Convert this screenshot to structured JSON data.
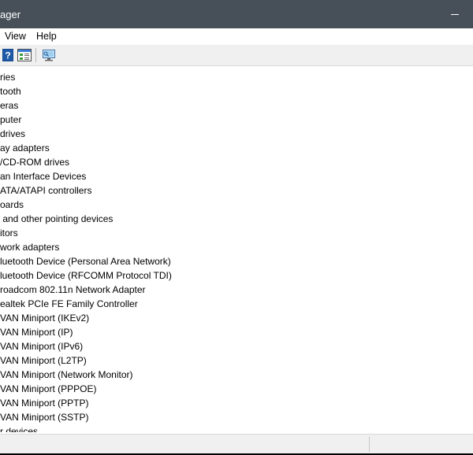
{
  "window": {
    "title": "ager"
  },
  "menu": {
    "items": [
      "View",
      "Help"
    ]
  },
  "toolbar": {
    "buttons": [
      "help-icon",
      "properties-icon",
      "scan-hardware-icon"
    ]
  },
  "tree": {
    "rows": [
      "ries",
      "tooth",
      "eras",
      "puter",
      "drives",
      "ay adapters",
      "/CD-ROM drives",
      "an Interface Devices",
      "ATA/ATAPI controllers",
      "oards",
      " and other pointing devices",
      "itors",
      "work adapters",
      "luetooth Device (Personal Area Network)",
      "luetooth Device (RFCOMM Protocol TDI)",
      "roadcom 802.11n Network Adapter",
      "ealtek PCIe FE Family Controller",
      "VAN Miniport (IKEv2)",
      "VAN Miniport (IP)",
      "VAN Miniport (IPv6)",
      "VAN Miniport (L2TP)",
      "VAN Miniport (Network Monitor)",
      "VAN Miniport (PPPOE)",
      "VAN Miniport (PPTP)",
      "VAN Miniport (SSTP)",
      "r devices"
    ]
  },
  "colors": {
    "titlebar": "#475059",
    "toolbar": "#f0f0f0",
    "window": "#ffffff"
  }
}
